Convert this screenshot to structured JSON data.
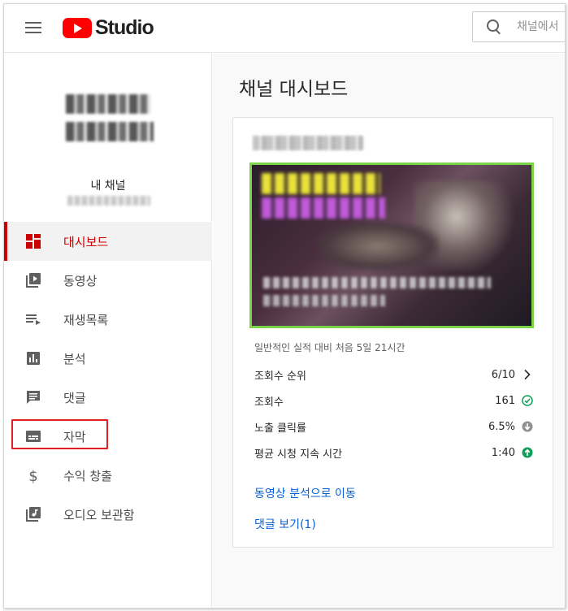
{
  "header": {
    "logo_text": "Studio",
    "search_placeholder": "채널에서"
  },
  "sidebar": {
    "channel_label": "내 채널",
    "items": [
      {
        "label": "대시보드",
        "icon": "dashboard-icon",
        "active": true
      },
      {
        "label": "동영상",
        "icon": "video-library-icon",
        "active": false
      },
      {
        "label": "재생목록",
        "icon": "playlist-icon",
        "active": false
      },
      {
        "label": "분석",
        "icon": "analytics-icon",
        "active": false
      },
      {
        "label": "댓글",
        "icon": "comment-icon",
        "active": false
      },
      {
        "label": "자막",
        "icon": "subtitles-icon",
        "active": false
      },
      {
        "label": "수익 창출",
        "icon": "dollar-icon",
        "active": false
      },
      {
        "label": "오디오 보관함",
        "icon": "audio-library-icon",
        "active": false
      }
    ]
  },
  "main": {
    "title": "채널 대시보드",
    "card": {
      "caption": "일반적인 실적 대비 처음 5일 21시간",
      "metrics": [
        {
          "label": "조회수 순위",
          "value": "6/10",
          "icon": "chevron-right-icon"
        },
        {
          "label": "조회수",
          "value": "161",
          "icon": "check-circle-icon"
        },
        {
          "label": "노출 클릭률",
          "value": "6.5%",
          "icon": "arrow-down-circle-icon"
        },
        {
          "label": "평균 시청 지속 시간",
          "value": "1:40",
          "icon": "arrow-up-circle-icon"
        }
      ],
      "link_analytics": "동영상 분석으로 이동",
      "link_comments": "댓글 보기(1)"
    }
  },
  "colors": {
    "accent_red": "#cc0000",
    "link_blue": "#065fd4",
    "success_green": "#0f9d58",
    "neutral_gray": "#909090",
    "thumbnail_border": "#7bd34a"
  }
}
